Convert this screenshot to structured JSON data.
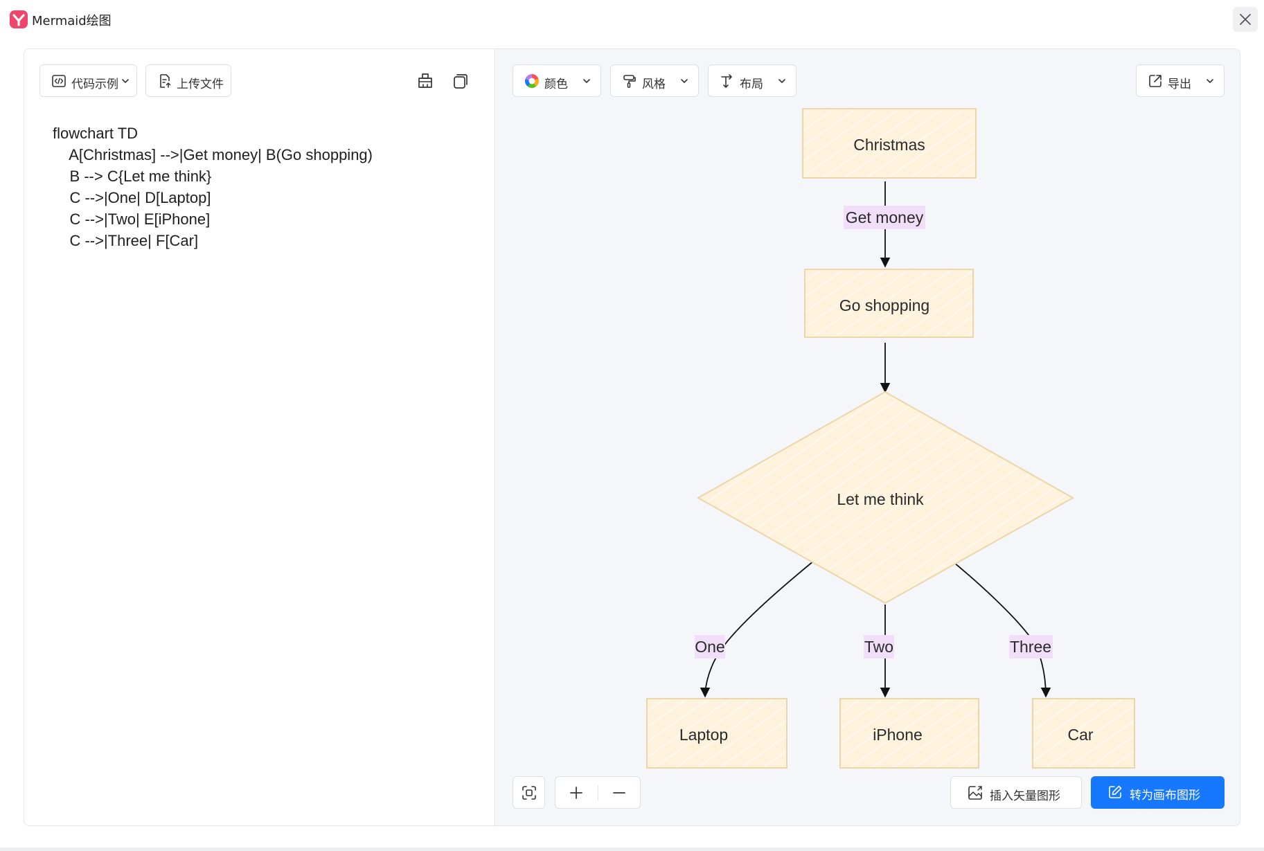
{
  "app": {
    "title": "Mermaid绘图"
  },
  "editor": {
    "toolbar": {
      "examples_label": "代码示例",
      "upload_label": "上传文件"
    },
    "code_lines": [
      "flowchart TD",
      "    A[Christmas] -->|Get money| B(Go shopping)",
      "    B --> C{Let me think}",
      "    C -->|One| D[Laptop]",
      "    C -->|Two| E[iPhone]",
      "    C -->|Three| F[Car]"
    ]
  },
  "canvas": {
    "toolbar": {
      "color_label": "颜色",
      "style_label": "风格",
      "layout_label": "布局",
      "export_label": "导出"
    },
    "actions": {
      "insert_vector_label": "插入矢量图形",
      "convert_label": "转为画布图形"
    },
    "flowchart": {
      "nodes": {
        "A": "Christmas",
        "B": "Go shopping",
        "C": "Let me think",
        "D": "Laptop",
        "E": "iPhone",
        "F": "Car"
      },
      "edge_labels": {
        "AB": "Get money",
        "CD": "One",
        "CE": "Two",
        "CF": "Three"
      }
    }
  },
  "colors": {
    "node_fill": "#fdf2dc",
    "node_stroke": "#ecd5a8",
    "edge_label_bg": "#f1def8",
    "primary": "#1677ff",
    "brand": "#f0446a"
  }
}
